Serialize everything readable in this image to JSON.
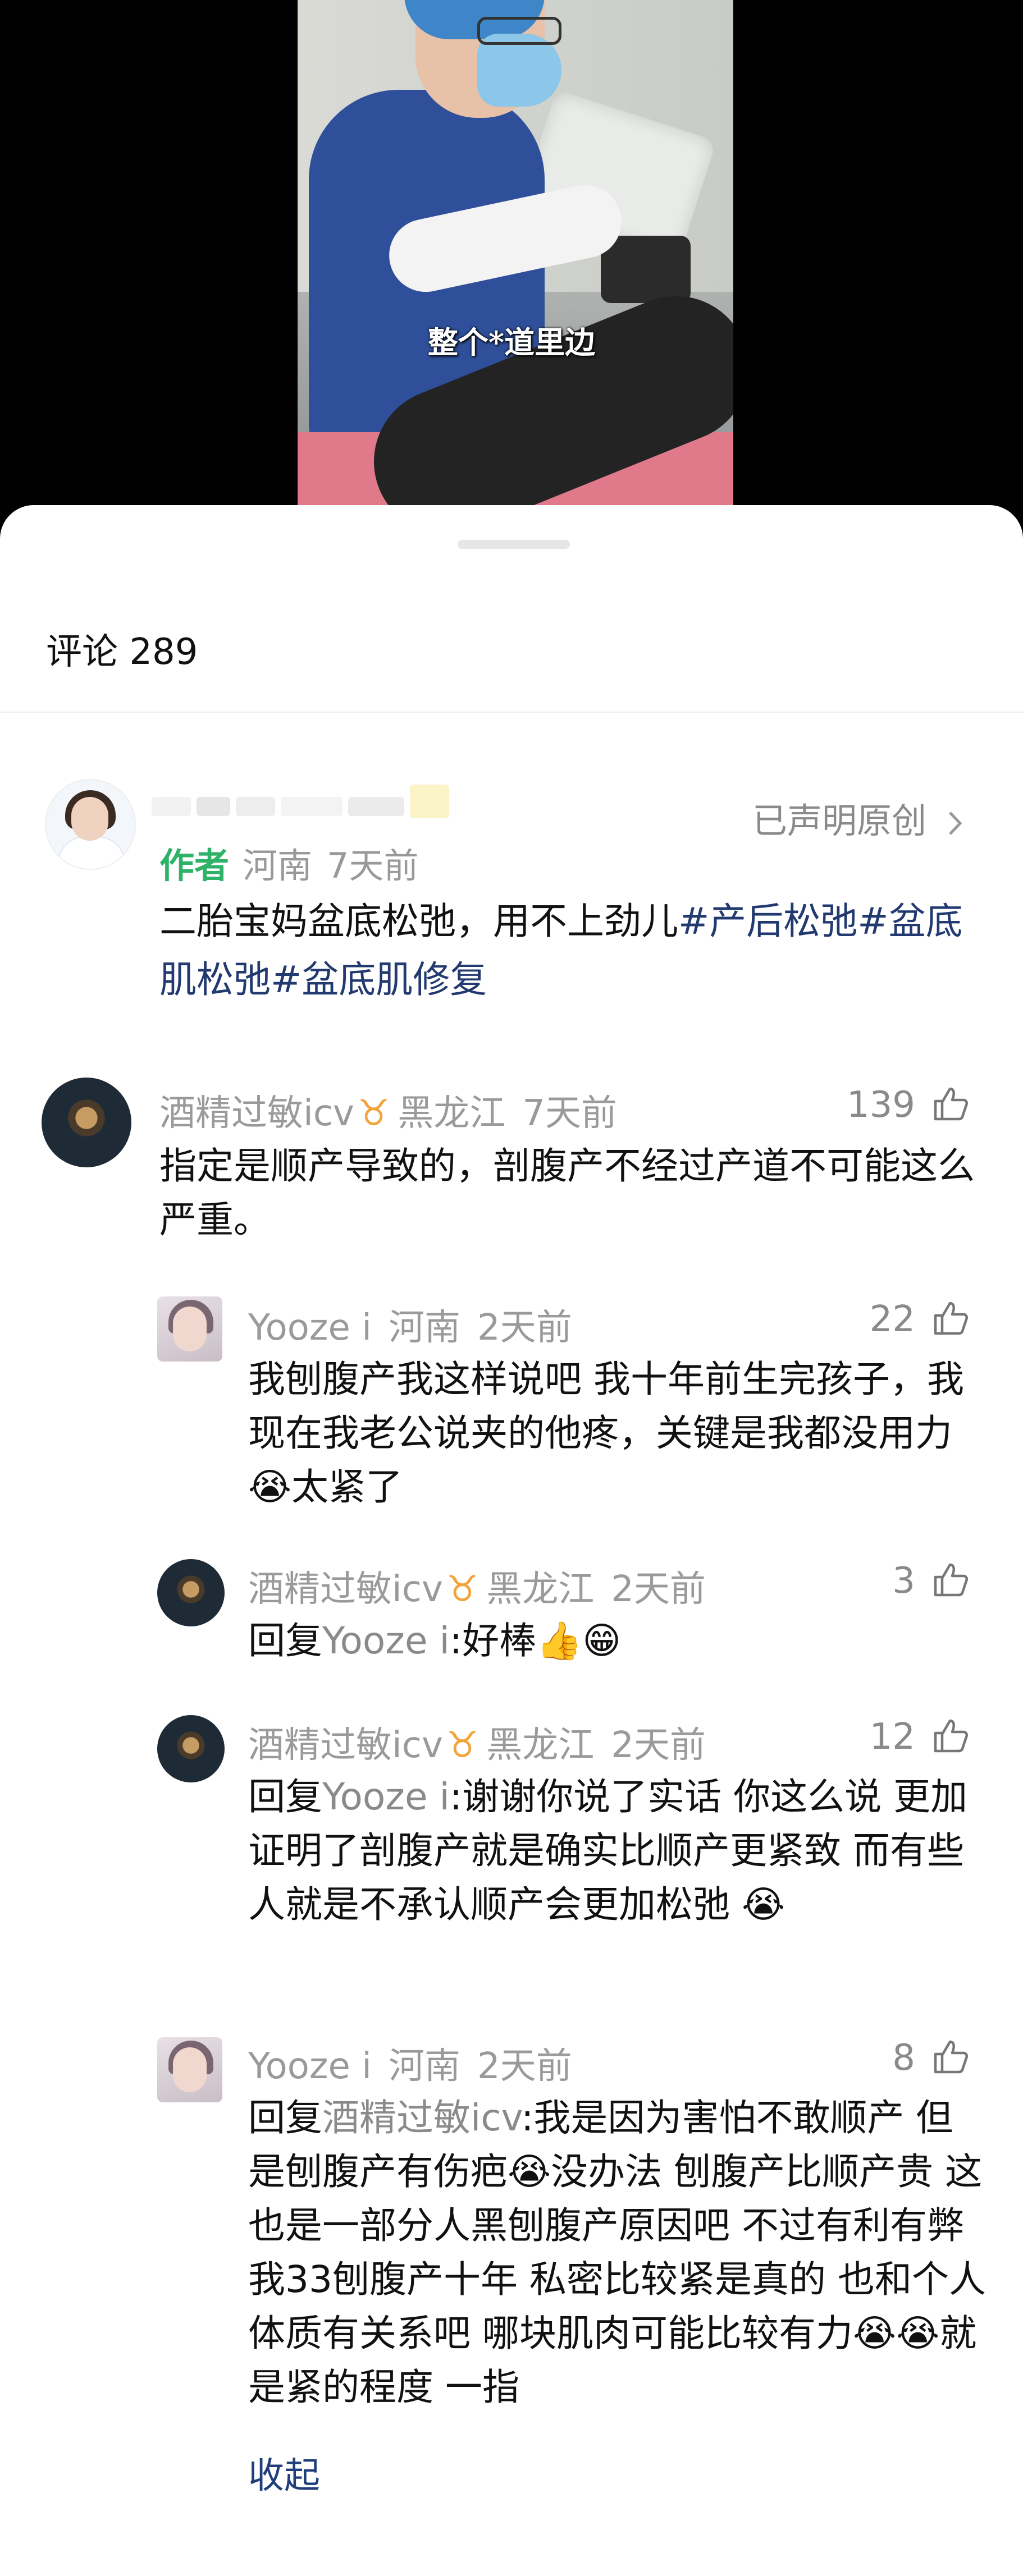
{
  "video": {
    "subtitle": "整个*道里边"
  },
  "comments_panel": {
    "title": "评论 289",
    "pinned": {
      "author_tag": "作者",
      "location": "河南",
      "time": "7天前",
      "declaration": "已声明原创",
      "chevron_icon": "chevron-right-icon",
      "text_before": "二胎宝妈盆底松弛，用不上劲儿",
      "hashtags": [
        "#产后松弛#",
        "盆底肌松弛#盆底肌修复"
      ]
    },
    "comments": [
      {
        "user": "酒精过敏icv",
        "badge": "♉",
        "location": "黑龙江",
        "time": "7天前",
        "likes": "139",
        "text": "指定是顺产导致的，剖腹产不经过产道不可能这么严重。"
      },
      {
        "user": "Yooze i",
        "location": "河南",
        "time": "2天前",
        "likes": "22",
        "text": "我刨腹产我这样说吧 我十年前生完孩子，我现在我老公说夹的他疼，关键是我都没用力😭太紧了"
      },
      {
        "user": "酒精过敏icv",
        "badge": "♉",
        "location": "黑龙江",
        "time": "2天前",
        "likes": "3",
        "reply_prefix": "回复",
        "reply_to": "Yooze i",
        "text": ":好棒👍😁"
      },
      {
        "user": "酒精过敏icv",
        "badge": "♉",
        "location": "黑龙江",
        "time": "2天前",
        "likes": "12",
        "reply_prefix": "回复",
        "reply_to": "Yooze i",
        "text": ":谢谢你说了实话    你这么说 更加证明了剖腹产就是确实比顺产更紧致 而有些人就是不承认顺产会更加松弛 😭"
      },
      {
        "user": "Yooze i",
        "location": "河南",
        "time": "2天前",
        "likes": "8",
        "reply_prefix": "回复",
        "reply_to": "酒精过敏icv",
        "text": ":我是因为害怕不敢顺产 但是刨腹产有伤疤😭没办法 刨腹产比顺产贵 这也是一部分人黑刨腹产原因吧 不过有利有弊  我33刨腹产十年 私密比较紧是真的  也和个人体质有关系吧  哪块肌肉可能比较有力😭😭就是紧的程度 一指",
        "collapse_label": "收起"
      }
    ]
  }
}
